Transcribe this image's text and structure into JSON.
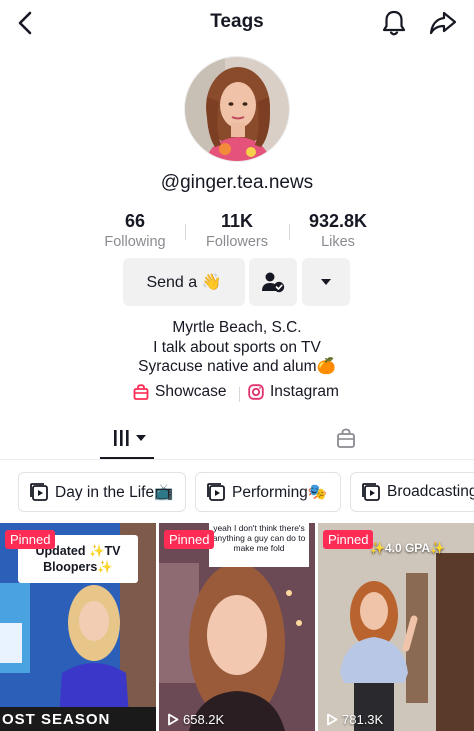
{
  "header": {
    "title": "Teags"
  },
  "profile": {
    "username": "@ginger.tea.news",
    "stats": [
      {
        "value": "66",
        "label": "Following"
      },
      {
        "value": "11K",
        "label": "Followers"
      },
      {
        "value": "932.8K",
        "label": "Likes"
      }
    ],
    "send_button": "Send a 👋",
    "bio": [
      "Myrtle Beach, S.C.",
      "I talk about sports on TV",
      "Syracuse native and alum🍊"
    ],
    "links": {
      "showcase": "Showcase",
      "instagram": "Instagram"
    }
  },
  "playlists": [
    "Day in the Life📺",
    "Performing🎭",
    "Broadcasting"
  ],
  "videos": [
    {
      "pinned": "Pinned",
      "overlay": "Updated ✨TV Bloopers✨",
      "caption": "OST SEASON",
      "views": ""
    },
    {
      "pinned": "Pinned",
      "overlay": "yeah I don't think there's anything a guy can do to make me fold",
      "views": "658.2K"
    },
    {
      "pinned": "Pinned",
      "overlay": "✨4.0 GPA✨",
      "views": "781.3K"
    }
  ],
  "colors": {
    "accent": "#fe2c55",
    "text": "#161823",
    "secondary": "#8a8b91"
  },
  "icons": [
    "back-arrow-icon",
    "bell-icon",
    "share-icon",
    "person-check-icon",
    "chevron-down-icon",
    "showcase-bag-icon",
    "instagram-icon",
    "grid-icon",
    "shop-bag-icon",
    "playlist-icon",
    "play-icon"
  ]
}
